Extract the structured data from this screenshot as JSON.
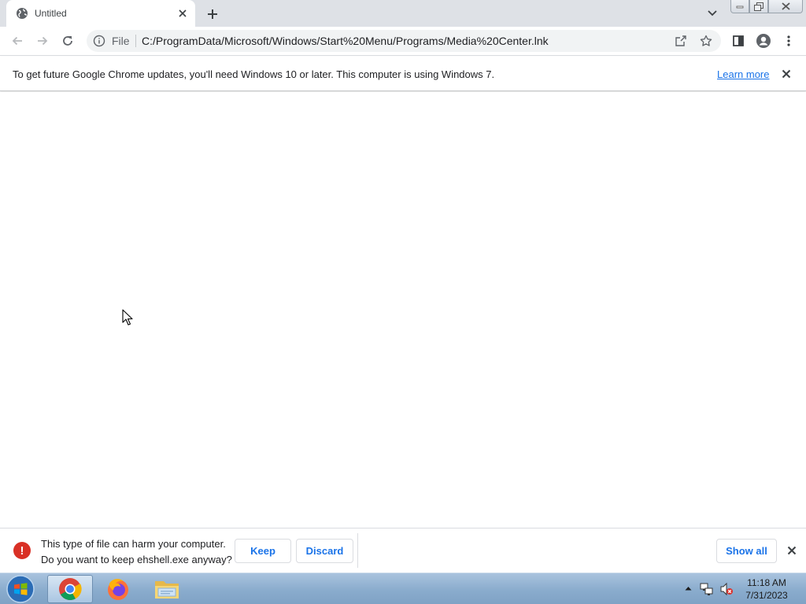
{
  "tab": {
    "title": "Untitled",
    "favicon": "globe-icon"
  },
  "toolbar": {
    "scheme": "File",
    "url": "C:/ProgramData/Microsoft/Windows/Start%20Menu/Programs/Media%20Center.lnk"
  },
  "infobar": {
    "message": "To get future Google Chrome updates, you'll need Windows 10 or later. This computer is using Windows 7.",
    "link": "Learn more"
  },
  "download": {
    "warning_line1": "This type of file can harm your computer.",
    "warning_line2": "Do you want to keep ehshell.exe anyway?",
    "keep_label": "Keep",
    "discard_label": "Discard",
    "show_all_label": "Show all"
  },
  "taskbar": {
    "apps": [
      "chrome-icon",
      "firefox-icon",
      "explorer-icon"
    ],
    "time": "11:18 AM",
    "date": "7/31/2023"
  },
  "colors": {
    "accent": "#1a73e8",
    "danger": "#d93025",
    "tabstrip": "#dee1e6"
  }
}
